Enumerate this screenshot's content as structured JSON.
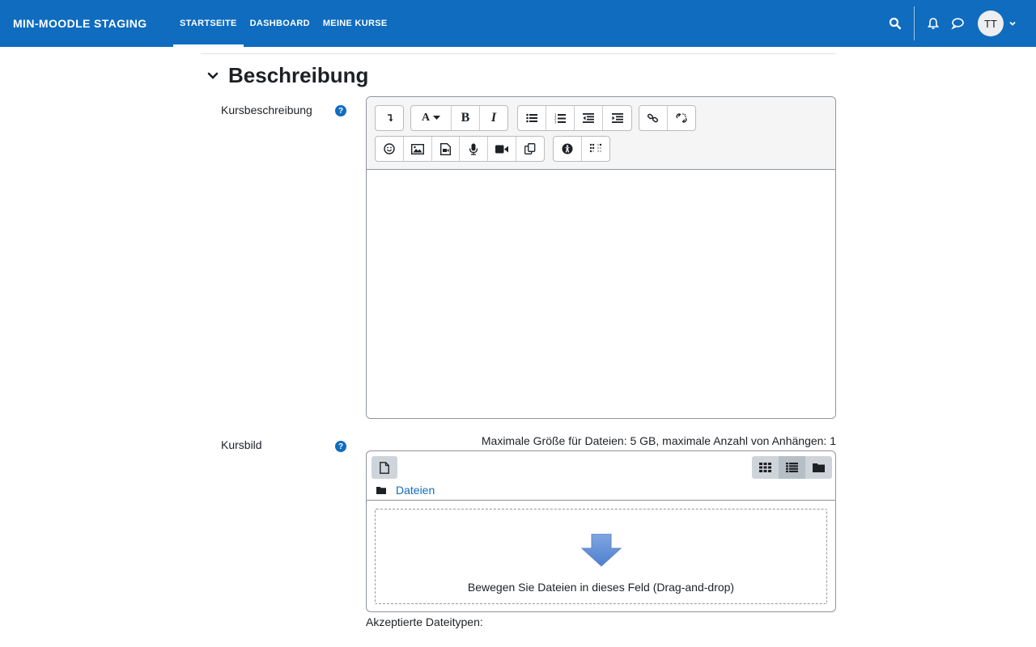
{
  "navbar": {
    "brand": "MIN-MOODLE STAGING",
    "links": [
      "STARTSEITE",
      "DASHBOARD",
      "MEINE KURSE"
    ],
    "avatar_initials": "TT",
    "icons": [
      "search-icon",
      "bell-icon",
      "chat-icon",
      "chevron-down-icon"
    ],
    "bg_color": "#0f6cbf"
  },
  "section": {
    "title": "Beschreibung"
  },
  "course_description": {
    "label": "Kursbeschreibung",
    "help": "?",
    "toolbar_row1": [
      "collapse",
      "font-color",
      "bold",
      "italic",
      "unordered-list",
      "ordered-list",
      "outdent",
      "indent",
      "link",
      "unlink"
    ],
    "toolbar_row2": [
      "emoji",
      "image",
      "media",
      "record-audio",
      "record-video",
      "manage-files",
      "accessibility-checker",
      "screenreader-helper"
    ],
    "text_labels": {
      "font": "A",
      "bold": "B",
      "italic": "I"
    }
  },
  "course_image": {
    "label": "Kursbild",
    "help": "?",
    "max_info": "Maximale Größe für Dateien: 5 GB, maximale Anzahl von Anhängen: 1",
    "path_label": "Dateien",
    "drop_text": "Bewegen Sie Dateien in dieses Feld (Drag-and-drop)",
    "accepted_types": "Akzeptierte Dateitypen:"
  }
}
